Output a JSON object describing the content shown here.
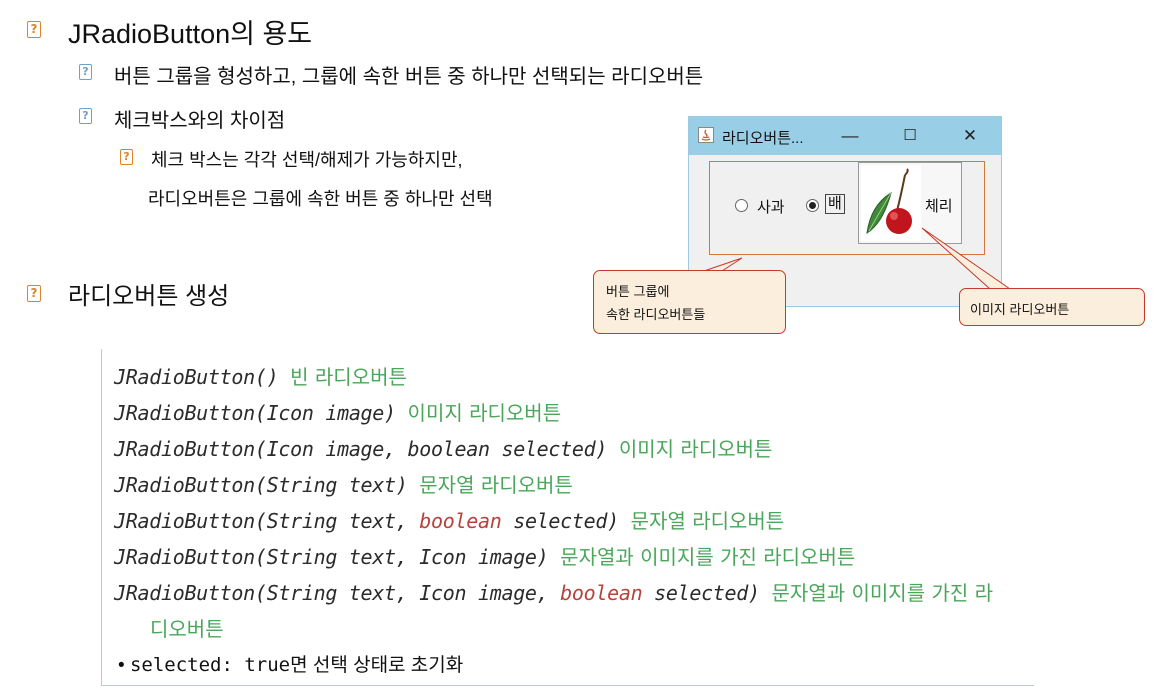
{
  "section1": {
    "title": "JRadioButton의 용도",
    "bullets": [
      "버튼 그룹을 형성하고, 그룹에 속한 버튼 중 하나만 선택되는 라디오버튼",
      "체크박스와의 차이점"
    ],
    "sub_bullet_line1": "체크 박스는 각각 선택/해제가 가능하지만,",
    "sub_bullet_line2": "라디오버튼은 그룹에 속한 버튼 중 하나만 선택"
  },
  "section2": {
    "title": "라디오버튼 생성"
  },
  "bullet_glyph": "?",
  "window": {
    "title": "라디오버튼...",
    "minimize": "—",
    "maximize": "☐",
    "close": "✕",
    "radio1_label": "사과",
    "radio1_selected": false,
    "radio2_label": "배",
    "radio2_selected": true,
    "image_button_label": "체리",
    "image_icon": "cherry-icon"
  },
  "callouts": {
    "group_line1": "버튼 그룹에",
    "group_line2": "속한 라디오버튼들",
    "image": "이미지 라디오버튼"
  },
  "constructors": [
    {
      "sig": "JRadioButton()",
      "desc": "빈 라디오버튼"
    },
    {
      "sig": "JRadioButton(Icon image)",
      "desc": "이미지 라디오버튼"
    },
    {
      "sig": "JRadioButton(Icon image, boolean selected)",
      "desc": "이미지 라디오버튼"
    },
    {
      "sig": "JRadioButton(String text)",
      "desc": "문자열 라디오버튼"
    },
    {
      "sig_pre": "JRadioButton(String text, ",
      "sig_kw": "boolean",
      "sig_post": " selected)",
      "desc": "문자열 라디오버튼"
    },
    {
      "sig": "JRadioButton(String text, Icon image)",
      "desc": "문자열과 이미지를 가진 라디오버튼"
    },
    {
      "sig_pre": "JRadioButton(String text, Icon image, ",
      "sig_kw": "boolean",
      "sig_post": " selected)",
      "desc": "문자열과 이미지를 가진 라",
      "desc_cont": "디오버튼"
    }
  ],
  "note": {
    "prefix": "• ",
    "mono1": "selected: true",
    "text": "면 선택 상태로 초기화"
  },
  "colors": {
    "bullet_orange": "#d9862b",
    "bullet_blue": "#6ea1c9",
    "desc_green": "#4aa65a",
    "keyword_red": "#b4433b",
    "titlebar": "#99cfe6",
    "callout_fill": "#fbeedd",
    "callout_border": "#c43a2a"
  }
}
